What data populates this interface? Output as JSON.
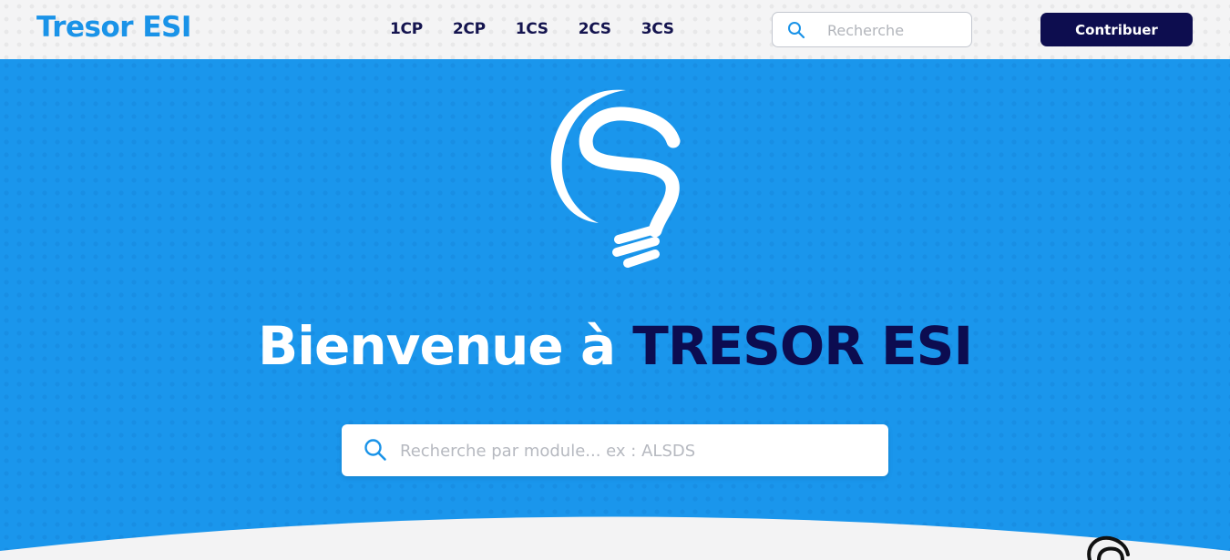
{
  "header": {
    "brand": "Tresor ESI",
    "nav": [
      {
        "label": "1CP"
      },
      {
        "label": "2CP"
      },
      {
        "label": "1CS"
      },
      {
        "label": "2CS"
      },
      {
        "label": "3CS"
      }
    ],
    "search": {
      "placeholder": "Recherche",
      "value": "",
      "icon": "search-icon"
    },
    "contribute_label": "Contribuer"
  },
  "hero": {
    "logo_icon": "lightbulb-logo",
    "title_part1": "Bienvenue à ",
    "title_part2": "TRESOR ESI",
    "search": {
      "placeholder": "Recherche par module... ex : ALSDS",
      "value": "",
      "icon": "search-icon"
    }
  },
  "colors": {
    "brand_blue": "#1a93e8",
    "hero_blue": "#1a96ec",
    "navy": "#0d0d4f",
    "nav_text": "#14144f"
  }
}
